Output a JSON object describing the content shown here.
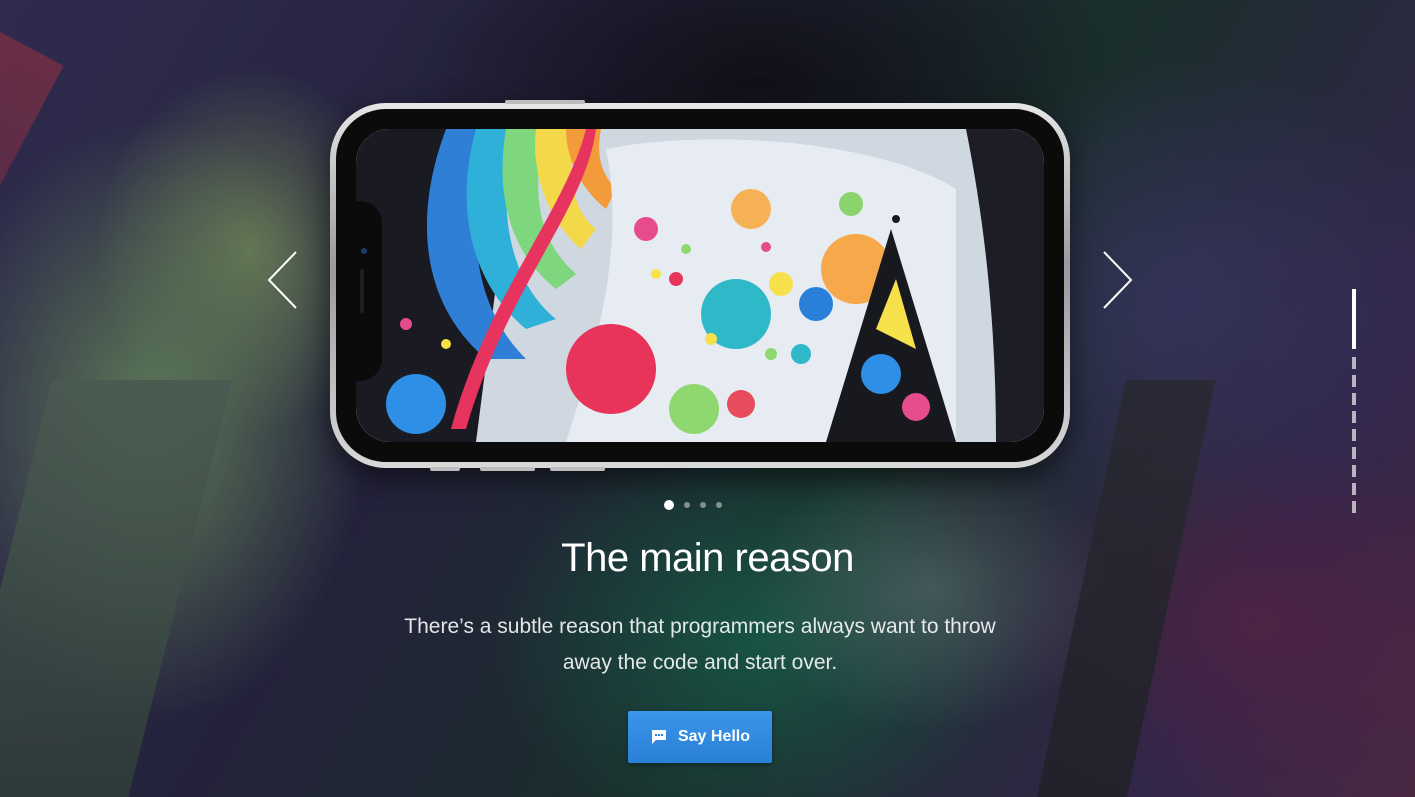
{
  "slider": {
    "title": "The main reason",
    "description": "There’s a subtle reason that programmers always want to throw away the code and start over.",
    "cta_label": "Say Hello",
    "slide_count": 4,
    "active_slide": 1
  },
  "icons": {
    "prev": "chevron-left-icon",
    "next": "chevron-right-icon",
    "cta": "chat-bubble-icon"
  },
  "colors": {
    "accent": "#2a86de",
    "text": "#ffffff"
  }
}
